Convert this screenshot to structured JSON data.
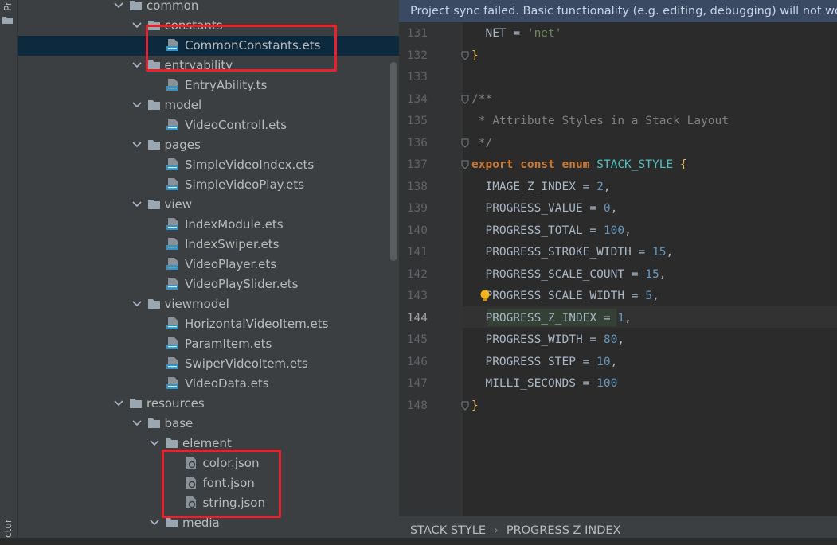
{
  "side_tool_window": {
    "top_label": "Pr",
    "bottom_label": "cture"
  },
  "tree": [
    {
      "label": "common",
      "kind": "folder",
      "expanded": true
    },
    {
      "label": "constants",
      "kind": "folder",
      "expanded": true
    },
    {
      "label": "CommonConstants.ets",
      "kind": "ets",
      "selected": true
    },
    {
      "label": "entryability",
      "kind": "folder",
      "expanded": true
    },
    {
      "label": "EntryAbility.ts",
      "kind": "ts"
    },
    {
      "label": "model",
      "kind": "folder",
      "expanded": true
    },
    {
      "label": "VideoControll.ets",
      "kind": "ets"
    },
    {
      "label": "pages",
      "kind": "folder",
      "expanded": true
    },
    {
      "label": "SimpleVideoIndex.ets",
      "kind": "ets"
    },
    {
      "label": "SimpleVideoPlay.ets",
      "kind": "ets"
    },
    {
      "label": "view",
      "kind": "folder",
      "expanded": true
    },
    {
      "label": "IndexModule.ets",
      "kind": "ets"
    },
    {
      "label": "IndexSwiper.ets",
      "kind": "ets"
    },
    {
      "label": "VideoPlayer.ets",
      "kind": "ets"
    },
    {
      "label": "VideoPlaySlider.ets",
      "kind": "ets"
    },
    {
      "label": "viewmodel",
      "kind": "folder",
      "expanded": true
    },
    {
      "label": "HorizontalVideoItem.ets",
      "kind": "ets"
    },
    {
      "label": "ParamItem.ets",
      "kind": "ets"
    },
    {
      "label": "SwiperVideoItem.ets",
      "kind": "ets"
    },
    {
      "label": "VideoData.ets",
      "kind": "ets"
    },
    {
      "label": "resources",
      "kind": "folder",
      "expanded": true
    },
    {
      "label": "base",
      "kind": "folder",
      "expanded": true
    },
    {
      "label": "element",
      "kind": "folder",
      "expanded": true
    },
    {
      "label": "color.json",
      "kind": "json"
    },
    {
      "label": "font.json",
      "kind": "json"
    },
    {
      "label": "string.json",
      "kind": "json"
    },
    {
      "label": "media",
      "kind": "folder",
      "expanded": true
    }
  ],
  "editor": {
    "notification": "Project sync failed. Basic functionality (e.g. editing, debugging) will not wo",
    "current_line": "144",
    "lines": [
      {
        "num": "131",
        "tokens": [
          [
            "plain",
            "  NET = "
          ],
          [
            "s",
            "'net'"
          ]
        ]
      },
      {
        "num": "132",
        "tokens": [
          [
            "b",
            "}"
          ]
        ]
      },
      {
        "num": "133",
        "tokens": []
      },
      {
        "num": "134",
        "tokens": [
          [
            "c",
            "/**"
          ]
        ]
      },
      {
        "num": "135",
        "tokens": [
          [
            "c",
            " * Attribute Styles in a Stack Layout"
          ]
        ]
      },
      {
        "num": "136",
        "tokens": [
          [
            "c",
            " */"
          ]
        ]
      },
      {
        "num": "137",
        "tokens": [
          [
            "k",
            "export const enum "
          ],
          [
            "t",
            "STACK_STYLE "
          ],
          [
            "b",
            "{"
          ]
        ]
      },
      {
        "num": "138",
        "tokens": [
          [
            "plain",
            "  IMAGE_Z_INDEX = "
          ],
          [
            "n",
            "2"
          ],
          [
            "plain",
            ","
          ]
        ]
      },
      {
        "num": "139",
        "tokens": [
          [
            "plain",
            "  PROGRESS_VALUE = "
          ],
          [
            "n",
            "0"
          ],
          [
            "plain",
            ","
          ]
        ]
      },
      {
        "num": "140",
        "tokens": [
          [
            "plain",
            "  PROGRESS_TOTAL = "
          ],
          [
            "n",
            "100"
          ],
          [
            "plain",
            ","
          ]
        ]
      },
      {
        "num": "141",
        "tokens": [
          [
            "plain",
            "  PROGRESS_STROKE_WIDTH = "
          ],
          [
            "n",
            "15"
          ],
          [
            "plain",
            ","
          ]
        ]
      },
      {
        "num": "142",
        "tokens": [
          [
            "plain",
            "  PROGRESS_SCALE_COUNT = "
          ],
          [
            "n",
            "15"
          ],
          [
            "plain",
            ","
          ]
        ]
      },
      {
        "num": "143",
        "tokens": [
          [
            "plain",
            "  PROGRESS_SCALE_WIDTH = "
          ],
          [
            "n",
            "5"
          ],
          [
            "plain",
            ","
          ]
        ]
      },
      {
        "num": "144",
        "tokens": [
          [
            "plain",
            "  PROGRESS_Z_INDEX = "
          ],
          [
            "n",
            "1"
          ],
          [
            "plain",
            ","
          ]
        ]
      },
      {
        "num": "145",
        "tokens": [
          [
            "plain",
            "  PROGRESS_WIDTH = "
          ],
          [
            "n",
            "80"
          ],
          [
            "plain",
            ","
          ]
        ]
      },
      {
        "num": "146",
        "tokens": [
          [
            "plain",
            "  PROGRESS_STEP = "
          ],
          [
            "n",
            "10"
          ],
          [
            "plain",
            ","
          ]
        ]
      },
      {
        "num": "147",
        "tokens": [
          [
            "plain",
            "  MILLI_SECONDS = "
          ],
          [
            "n",
            "100"
          ]
        ]
      },
      {
        "num": "148",
        "tokens": [
          [
            "b",
            "}"
          ]
        ]
      }
    ]
  },
  "breadcrumb": {
    "items": [
      "STACK STYLE",
      "PROGRESS Z INDEX"
    ],
    "separator": "›"
  },
  "colors": {
    "tree_bg": "#3c3f41",
    "editor_bg": "#2b2b2b",
    "selection": "#0d293e",
    "notification_bg": "#3a4a63",
    "highlight_box": "#e8212b"
  },
  "icons": {
    "expanded_arrow": "chevron-down-icon",
    "folder": "folder-icon",
    "ets_file": "ets-file-icon",
    "ts_file": "ts-file-icon",
    "json_file": "json-file-icon",
    "intention": "lightbulb-icon",
    "fold_marker": "fold-marker-icon"
  }
}
